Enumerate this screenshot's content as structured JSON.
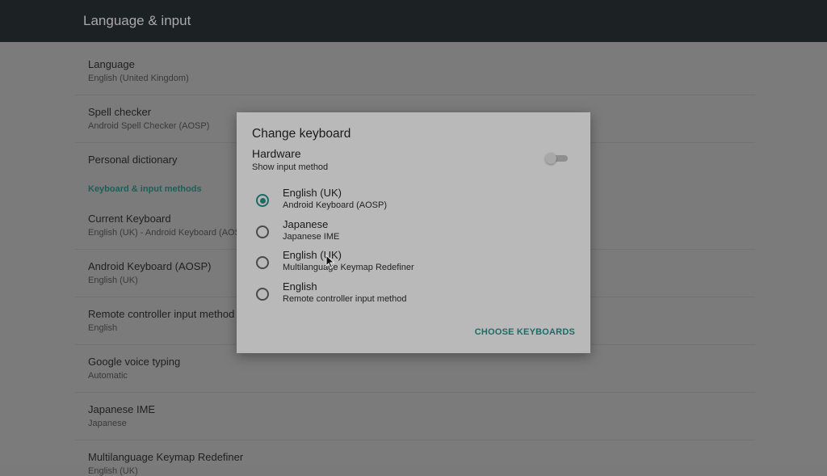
{
  "appbar": {
    "title": "Language & input"
  },
  "settings": {
    "rows": [
      {
        "title": "Language",
        "subtitle": "English (United Kingdom)"
      },
      {
        "title": "Spell checker",
        "subtitle": "Android Spell Checker (AOSP)"
      },
      {
        "title": "Personal dictionary",
        "subtitle": ""
      }
    ],
    "section_header": "Keyboard & input methods",
    "rows2": [
      {
        "title": "Current Keyboard",
        "subtitle": "English (UK) - Android Keyboard (AOSP)"
      },
      {
        "title": "Android Keyboard (AOSP)",
        "subtitle": "English (UK)"
      },
      {
        "title": "Remote controller input method",
        "subtitle": "English"
      },
      {
        "title": "Google voice typing",
        "subtitle": "Automatic"
      },
      {
        "title": "Japanese IME",
        "subtitle": "Japanese"
      },
      {
        "title": "Multilanguage Keymap Redefiner",
        "subtitle": "English (UK)"
      }
    ]
  },
  "dialog": {
    "title": "Change keyboard",
    "hardware_title": "Hardware",
    "hardware_subtitle": "Show input method",
    "hardware_toggle_on": false,
    "options": [
      {
        "title": "English (UK)",
        "subtitle": "Android Keyboard (AOSP)",
        "selected": true
      },
      {
        "title": "Japanese",
        "subtitle": "Japanese IME",
        "selected": false
      },
      {
        "title": "English (UK)",
        "subtitle": "Multilanguage Keymap Redefiner",
        "selected": false
      },
      {
        "title": "English",
        "subtitle": "Remote controller input method",
        "selected": false
      }
    ],
    "choose_button": "CHOOSE KEYBOARDS"
  },
  "colors": {
    "accent": "#1d6b66",
    "appbar": "#1c2124",
    "dialog_bg": "#b9b9b9"
  }
}
